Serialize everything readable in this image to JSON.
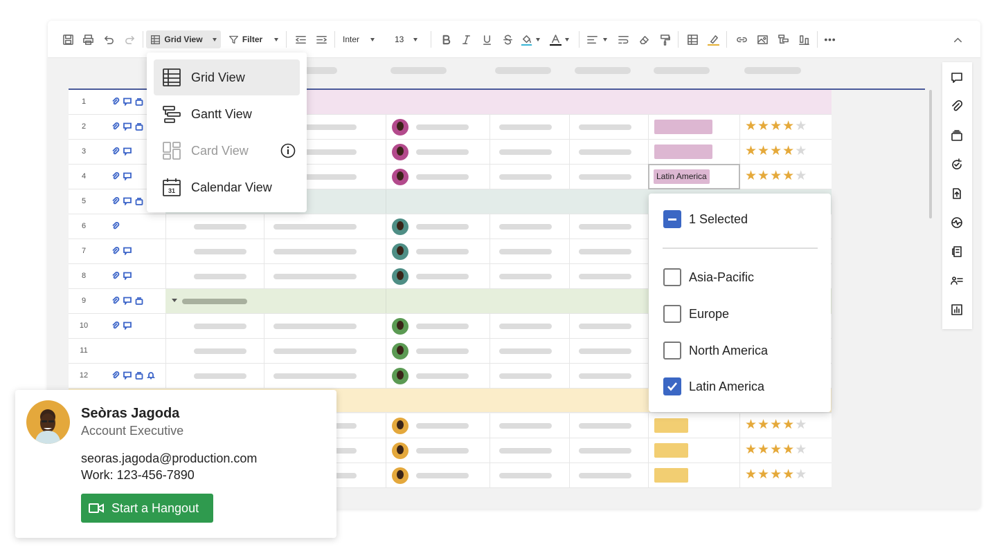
{
  "toolbar": {
    "view_label": "Grid View",
    "filter_label": "Filter",
    "font_family": "Inter",
    "font_size": "13"
  },
  "view_menu": {
    "items": [
      {
        "label": "Grid View",
        "icon": "grid-view-icon",
        "active": true
      },
      {
        "label": "Gantt View",
        "icon": "gantt-view-icon",
        "active": false
      },
      {
        "label": "Card View",
        "icon": "card-view-icon",
        "active": false,
        "disabled": true
      },
      {
        "label": "Calendar View",
        "icon": "calendar-view-icon",
        "active": false,
        "calendar_day": "31"
      }
    ]
  },
  "grid": {
    "row_numbers": [
      "1",
      "2",
      "3",
      "4",
      "5",
      "6",
      "7",
      "8",
      "9",
      "10",
      "11",
      "12"
    ],
    "selected_cell_value": "Latin America"
  },
  "region_dropdown": {
    "summary": "1 Selected",
    "options": [
      {
        "label": "Asia-Pacific",
        "checked": false
      },
      {
        "label": "Europe",
        "checked": false
      },
      {
        "label": "North America",
        "checked": false
      },
      {
        "label": "Latin America",
        "checked": true
      }
    ]
  },
  "contact_card": {
    "name": "Seòras Jagoda",
    "title": "Account Executive",
    "email": "seoras.jagoda@production.com",
    "work_phone": "Work: 123-456-7890",
    "hangout_label": "Start a Hangout"
  },
  "colors": {
    "accent_blue": "#3b67c4",
    "star": "#e5a93a",
    "hangout_green": "#2f9a4e",
    "tag_pink": "#ddb7d2",
    "tag_yellow": "#f2ce72"
  }
}
